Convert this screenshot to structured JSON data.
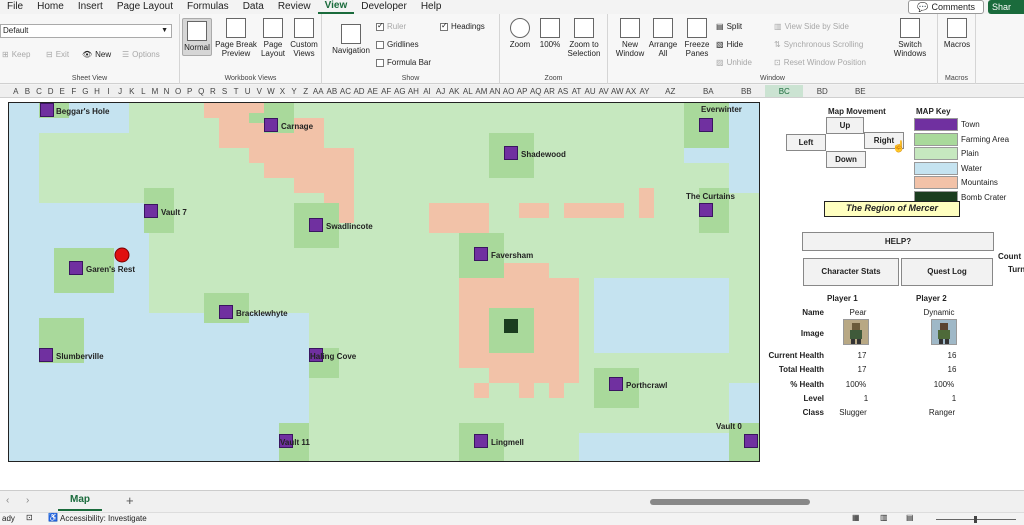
{
  "menu": [
    "File",
    "Home",
    "Insert",
    "Page Layout",
    "Formulas",
    "Data",
    "Review",
    "View",
    "Developer",
    "Help"
  ],
  "menu_active": "View",
  "top_right": {
    "comments": "Comments",
    "share": "Shar"
  },
  "sheet_view": {
    "dropdown_value": "Default",
    "keep": "Keep",
    "exit": "Exit",
    "new": "New",
    "options": "Options",
    "label": "Sheet View"
  },
  "workbook_views": {
    "normal": "Normal",
    "page_break": "Page Break Preview",
    "page_layout": "Page Layout",
    "custom": "Custom Views",
    "label": "Workbook Views"
  },
  "show": {
    "navigation": "Navigation",
    "ruler": "Ruler",
    "gridlines": "Gridlines",
    "formula_bar": "Formula Bar",
    "headings": "Headings",
    "label": "Show"
  },
  "zoom": {
    "zoom": "Zoom",
    "hundred": "100%",
    "selection": "Zoom to Selection",
    "label": "Zoom"
  },
  "window": {
    "new_window": "New Window",
    "arrange": "Arrange All",
    "freeze": "Freeze Panes",
    "split": "Split",
    "hide": "Hide",
    "unhide": "Unhide",
    "side_by_side": "View Side by Side",
    "sync": "Synchronous Scrolling",
    "reset": "Reset Window Position",
    "switch": "Switch Windows",
    "label": "Window"
  },
  "macros": {
    "macros": "Macros",
    "label": "Macros"
  },
  "columns": [
    "A",
    "B",
    "C",
    "D",
    "E",
    "F",
    "G",
    "H",
    "I",
    "J",
    "K",
    "L",
    "M",
    "N",
    "O",
    "P",
    "Q",
    "R",
    "S",
    "T",
    "U",
    "V",
    "W",
    "X",
    "Y",
    "Z",
    "AA",
    "AB",
    "AC",
    "AD",
    "AE",
    "AF",
    "AG",
    "AH",
    "AI",
    "AJ",
    "AK",
    "AL",
    "AM",
    "AN",
    "AO",
    "AP",
    "AQ",
    "AR",
    "AS",
    "AT",
    "AU",
    "AV",
    "AW",
    "AX",
    "AY",
    "AZ",
    "BA",
    "BB",
    "BC",
    "BD",
    "BE"
  ],
  "selected_column": "BC",
  "map": {
    "towns": [
      {
        "name": "Beggar's Hole"
      },
      {
        "name": "Carnage"
      },
      {
        "name": "Everwinter"
      },
      {
        "name": "Shadewood"
      },
      {
        "name": "The Curtains"
      },
      {
        "name": "Vault 7"
      },
      {
        "name": "Swadlincote"
      },
      {
        "name": "Faversham"
      },
      {
        "name": "Garen's Rest"
      },
      {
        "name": "Bracklewhyte"
      },
      {
        "name": "Slumberville"
      },
      {
        "name": "Haling Cove"
      },
      {
        "name": "Porthcrawl"
      },
      {
        "name": "Vault 11"
      },
      {
        "name": "Lingmell"
      },
      {
        "name": "Vault 0"
      }
    ]
  },
  "movement": {
    "title": "Map Movement",
    "up": "Up",
    "left": "Left",
    "right": "Right",
    "down": "Down"
  },
  "map_key": {
    "title": "MAP Key",
    "items": [
      {
        "label": "Town",
        "color": "#7030a0"
      },
      {
        "label": "Farming Area",
        "color": "#a9d99b"
      },
      {
        "label": "Plain",
        "color": "#c6e8bf"
      },
      {
        "label": "Water",
        "color": "#c5e3f0"
      },
      {
        "label": "Mountains",
        "color": "#f2c2a8"
      },
      {
        "label": "Bomb Crater",
        "color": "#1b3d1f"
      }
    ]
  },
  "region": "The Region of Mercer",
  "buttons": {
    "help": "HELP?",
    "stats": "Character Stats",
    "quest": "Quest Log"
  },
  "side_cut": {
    "count": "Count",
    "turn": "Turn"
  },
  "players": {
    "p1_title": "Player 1",
    "p2_title": "Player 2",
    "labels": [
      "Name",
      "Image",
      "Current Health",
      "Total Health",
      "% Health",
      "Level",
      "Class"
    ],
    "p1": {
      "name": "Pear",
      "current": "17",
      "total": "17",
      "pct": "100%",
      "level": "1",
      "class": "Slugger"
    },
    "p2": {
      "name": "Dynamic",
      "current": "16",
      "total": "16",
      "pct": "100%",
      "level": "1",
      "class": "Ranger"
    }
  },
  "tab": {
    "name": "Map",
    "add": "+"
  },
  "status": {
    "ready": "ady",
    "accessibility": "Accessibility: Investigate"
  }
}
